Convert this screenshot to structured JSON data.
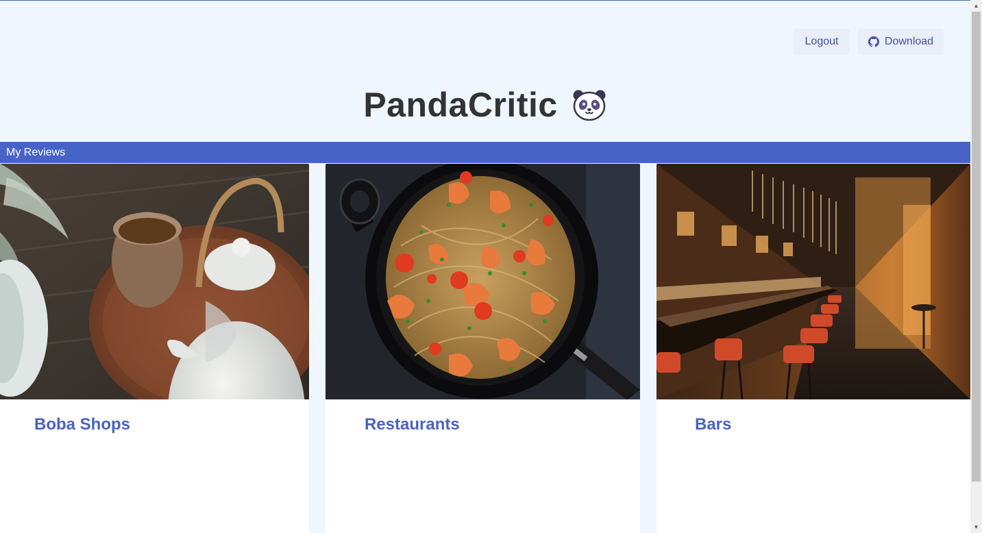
{
  "header": {
    "logout_label": "Logout",
    "download_label": "Download",
    "download_icon": "github-icon"
  },
  "app": {
    "title": "PandaCritic",
    "logo_icon": "panda-face-icon"
  },
  "nav": {
    "label": "My Reviews"
  },
  "cards": [
    {
      "title": "Boba Shops",
      "image": "teapot-and-tea-cup-photo"
    },
    {
      "title": "Restaurants",
      "image": "shrimp-spaghetti-pan-photo"
    },
    {
      "title": "Bars",
      "image": "bar-interior-photo"
    }
  ],
  "colors": {
    "page_bg": "#eff6fe",
    "nav_bg": "#4763c8",
    "card_title": "#4a63c0",
    "title_text": "#333333"
  }
}
